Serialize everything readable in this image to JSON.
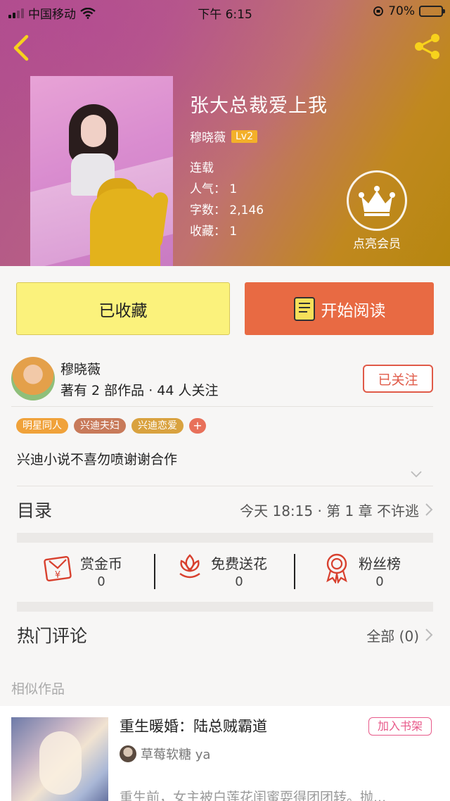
{
  "status_bar": {
    "carrier": "中国移动",
    "time": "下午 6:15",
    "battery": "70%"
  },
  "book": {
    "title": "张大总裁爱上我",
    "author": "穆晓薇",
    "level": "Lv2",
    "status": "连载",
    "popularity": "人气：  1",
    "word_count": "字数：  2,146",
    "favorites": "收藏：  1",
    "vip_label": "点亮会员"
  },
  "buttons": {
    "favorite": "已收藏",
    "read": "开始阅读"
  },
  "author_card": {
    "name": "穆晓薇",
    "stats": "著有 2 部作品 · 44 人关注",
    "follow": "已关注"
  },
  "tags": [
    {
      "label": "明星同人",
      "color": "#f0a23a"
    },
    {
      "label": "兴迪夫妇",
      "color": "#c87a5a"
    },
    {
      "label": "兴迪恋爱",
      "color": "#d9a23f"
    }
  ],
  "tag_more": "+",
  "description": "兴迪小说不喜勿喷谢谢合作",
  "toc": {
    "label": "目录",
    "latest": "今天 18:15 · 第 1 章 不许逃"
  },
  "actions": [
    {
      "label": "赏金币",
      "count": "0",
      "icon": "red-envelope-icon"
    },
    {
      "label": "免费送花",
      "count": "0",
      "icon": "flower-icon"
    },
    {
      "label": "粉丝榜",
      "count": "0",
      "icon": "medal-icon"
    }
  ],
  "comments": {
    "label": "热门评论",
    "all": "全部 (0)"
  },
  "similar": {
    "section_title": "相似作品",
    "item": {
      "title": "重生暖婚：陆总贼霸道",
      "add_label": "加入书架",
      "author": "草莓软糖 ya",
      "desc": "重生前，女主被白莲花闺蜜耍得团团转。抛..."
    }
  },
  "colors": {
    "accent_orange": "#e86a43",
    "favorite_yellow": "#fbf27c",
    "follow_red": "#e05a48",
    "icon_red": "#d8402e"
  }
}
